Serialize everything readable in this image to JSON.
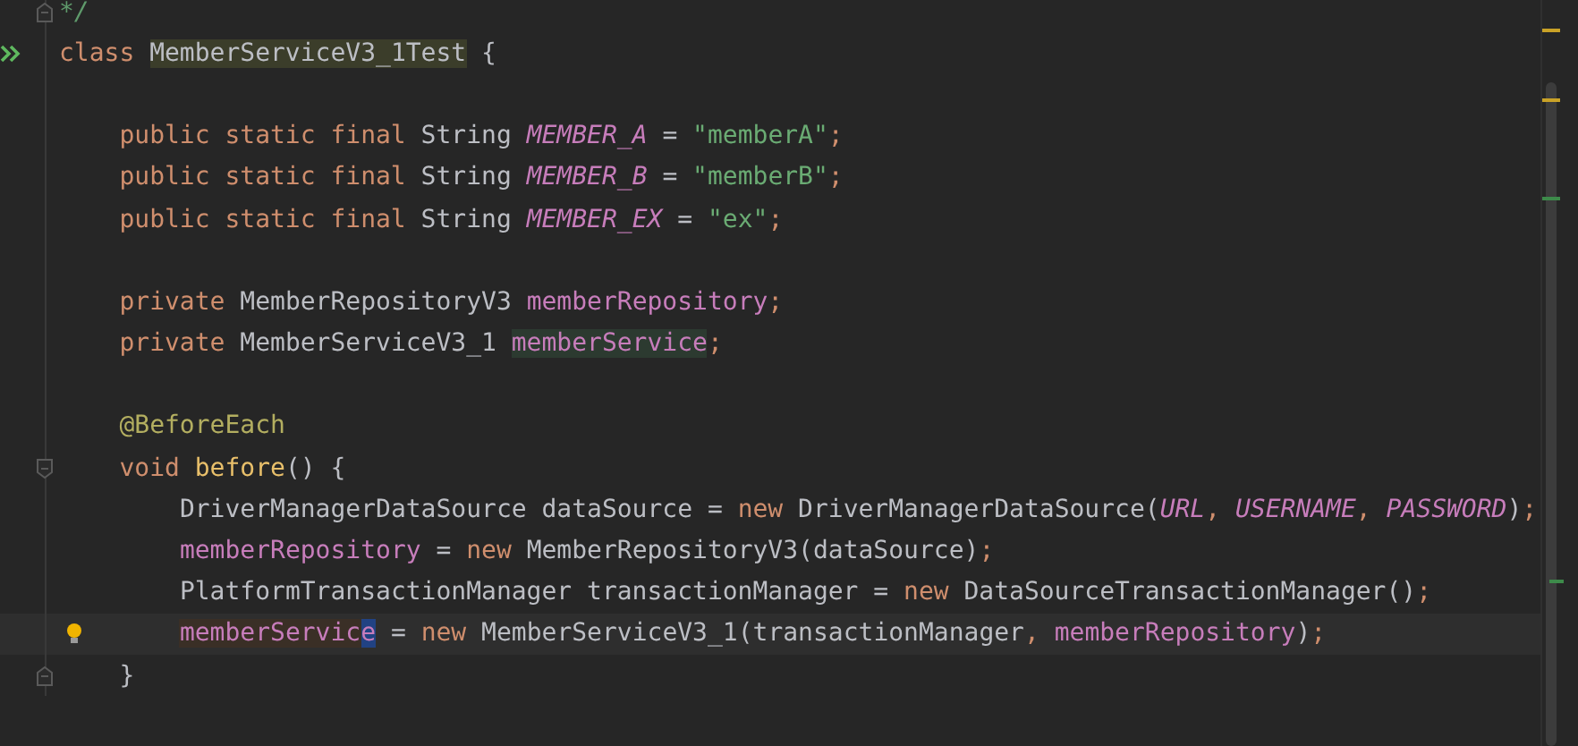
{
  "editor": {
    "lines": [
      {
        "kind": "fold-end",
        "tokens": [
          {
            "t": "*/",
            "kind": "comment"
          }
        ]
      },
      {
        "kind": "run",
        "tokens": [
          {
            "t": "class ",
            "kind": "keyword"
          },
          {
            "t": "MemberServiceV3_1Test",
            "kind": "declaration"
          },
          {
            "t": " {",
            "kind": "plain"
          }
        ]
      },
      {
        "kind": "plain"
      },
      {
        "kind": "plain",
        "tokens": [
          {
            "t": "    public static final ",
            "kind": "keyword"
          },
          {
            "t": "String ",
            "kind": "plain"
          },
          {
            "t": "MEMBER_A",
            "kind": "constant"
          },
          {
            "t": " = ",
            "kind": "plain"
          },
          {
            "t": "\"memberA\"",
            "kind": "string"
          },
          {
            "t": ";",
            "kind": "keyword"
          }
        ]
      },
      {
        "kind": "plain",
        "tokens": [
          {
            "t": "    public static final ",
            "kind": "keyword"
          },
          {
            "t": "String ",
            "kind": "plain"
          },
          {
            "t": "MEMBER_B",
            "kind": "constant"
          },
          {
            "t": " = ",
            "kind": "plain"
          },
          {
            "t": "\"memberB\"",
            "kind": "string"
          },
          {
            "t": ";",
            "kind": "keyword"
          }
        ]
      },
      {
        "kind": "plain",
        "tokens": [
          {
            "t": "    public static final ",
            "kind": "keyword"
          },
          {
            "t": "String ",
            "kind": "plain"
          },
          {
            "t": "MEMBER_EX",
            "kind": "constant"
          },
          {
            "t": " = ",
            "kind": "plain"
          },
          {
            "t": "\"ex\"",
            "kind": "string"
          },
          {
            "t": ";",
            "kind": "keyword"
          }
        ]
      },
      {
        "kind": "plain"
      },
      {
        "kind": "plain",
        "tokens": [
          {
            "t": "    private ",
            "kind": "keyword"
          },
          {
            "t": "MemberRepositoryV3 ",
            "kind": "plain"
          },
          {
            "t": "memberRepository",
            "kind": "field"
          },
          {
            "t": ";",
            "kind": "keyword"
          }
        ]
      },
      {
        "kind": "plain",
        "tokens": [
          {
            "t": "    private ",
            "kind": "keyword"
          },
          {
            "t": "MemberServiceV3_1 ",
            "kind": "plain"
          },
          {
            "t": "memberService",
            "kind": "field-read"
          },
          {
            "t": ";",
            "kind": "keyword"
          }
        ]
      },
      {
        "kind": "plain"
      },
      {
        "kind": "plain",
        "tokens": [
          {
            "t": "    @BeforeEach",
            "kind": "annotation"
          }
        ]
      },
      {
        "kind": "fold-start",
        "tokens": [
          {
            "t": "    void ",
            "kind": "keyword"
          },
          {
            "t": "before",
            "kind": "method"
          },
          {
            "t": "() {",
            "kind": "plain"
          }
        ]
      },
      {
        "kind": "plain",
        "tokens": [
          {
            "t": "        DriverManagerDataSource dataSource = ",
            "kind": "plain"
          },
          {
            "t": "new ",
            "kind": "keyword"
          },
          {
            "t": "DriverManagerDataSource(",
            "kind": "plain"
          },
          {
            "t": "URL",
            "kind": "constant"
          },
          {
            "t": ", ",
            "kind": "keyword"
          },
          {
            "t": "USERNAME",
            "kind": "constant"
          },
          {
            "t": ", ",
            "kind": "keyword"
          },
          {
            "t": "PASSWORD",
            "kind": "constant"
          },
          {
            "t": ")",
            "kind": "plain"
          },
          {
            "t": ";",
            "kind": "keyword"
          }
        ]
      },
      {
        "kind": "plain",
        "tokens": [
          {
            "t": "        memberRepository",
            "kind": "field"
          },
          {
            "t": " = ",
            "kind": "plain"
          },
          {
            "t": "new ",
            "kind": "keyword"
          },
          {
            "t": "MemberRepositoryV3(dataSource)",
            "kind": "plain"
          },
          {
            "t": ";",
            "kind": "keyword"
          }
        ]
      },
      {
        "kind": "plain",
        "tokens": [
          {
            "t": "        PlatformTransactionManager transactionManager = ",
            "kind": "plain"
          },
          {
            "t": "new ",
            "kind": "keyword"
          },
          {
            "t": "DataSourceTransactionManager()",
            "kind": "plain"
          },
          {
            "t": ";",
            "kind": "keyword"
          }
        ]
      },
      {
        "kind": "bulb",
        "current": true,
        "tokens": [
          {
            "t": "        memberServic",
            "kind": "field-write"
          },
          {
            "t": "e",
            "kind": "field-write",
            "caret": true
          },
          {
            "t": " = ",
            "kind": "plain"
          },
          {
            "t": "new ",
            "kind": "keyword"
          },
          {
            "t": "MemberServiceV3_1(transactionManager",
            "kind": "plain"
          },
          {
            "t": ", ",
            "kind": "keyword"
          },
          {
            "t": "memberRepository",
            "kind": "field"
          },
          {
            "t": ")",
            "kind": "plain"
          },
          {
            "t": ";",
            "kind": "keyword"
          }
        ]
      },
      {
        "kind": "fold-end",
        "tokens": [
          {
            "t": "    }",
            "kind": "plain"
          }
        ]
      }
    ]
  }
}
